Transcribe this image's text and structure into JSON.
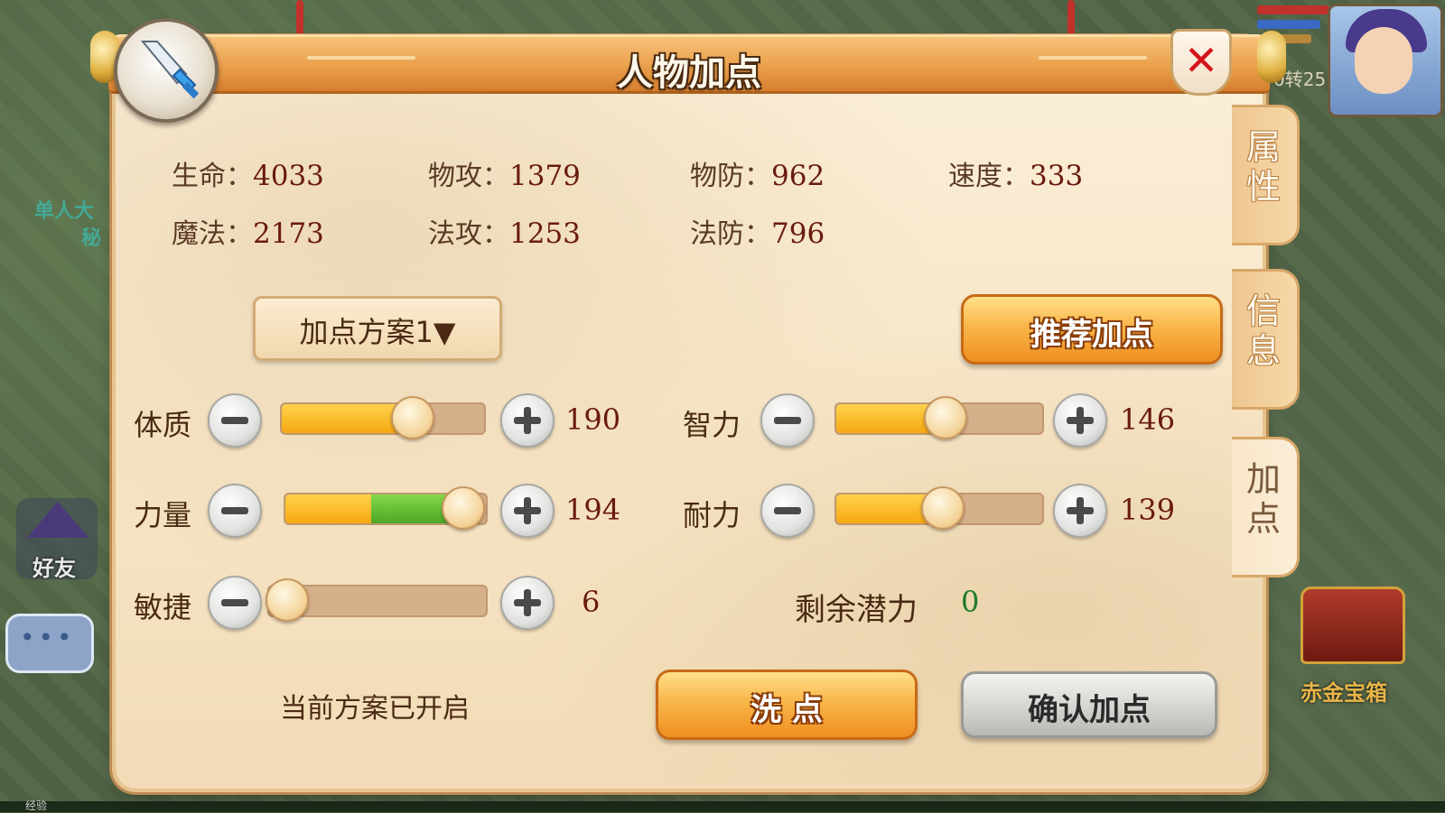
{
  "dialog": {
    "title": "人物加点",
    "close_glyph": "✕"
  },
  "side_tabs": [
    {
      "label": "属性",
      "active": false
    },
    {
      "label": "信息",
      "active": false
    },
    {
      "label": "加点",
      "active": true
    }
  ],
  "stats": [
    {
      "label": "生命：",
      "value": "4033"
    },
    {
      "label": "物攻：",
      "value": "1379"
    },
    {
      "label": "物防：",
      "value": "962"
    },
    {
      "label": "速度：",
      "value": "333"
    },
    {
      "label": "魔法：",
      "value": "2173"
    },
    {
      "label": "法攻：",
      "value": "1253"
    },
    {
      "label": "法防：",
      "value": "796"
    }
  ],
  "scheme_dropdown": {
    "label": "加点方案1▼"
  },
  "recommend_button": {
    "label": "推荐加点"
  },
  "attributes": [
    {
      "label": "体质",
      "value": "190",
      "base_fraction": 0.64,
      "added_fraction": 0.0
    },
    {
      "label": "智力",
      "value": "146",
      "base_fraction": 0.52,
      "added_fraction": 0.0
    },
    {
      "label": "力量",
      "value": "194",
      "base_fraction": 0.43,
      "added_fraction": 0.45
    },
    {
      "label": "耐力",
      "value": "139",
      "base_fraction": 0.51,
      "added_fraction": 0.0
    },
    {
      "label": "敏捷",
      "value": "6",
      "base_fraction": 0.0,
      "added_fraction": 0.0
    }
  ],
  "remaining_potential": {
    "label": "剩余潜力",
    "value": "0"
  },
  "scheme_status": "当前方案已开启",
  "reset_button": {
    "label": "洗 点"
  },
  "confirm_button": {
    "label": "确认加点"
  },
  "background": {
    "friends_label": "好友",
    "chest_label": "赤金宝箱",
    "level_text": "0转25",
    "left_event_text": "单人大",
    "left_event_text2": "秘",
    "exp_label": "经验"
  },
  "colors": {
    "title_bar": "#ea9f4a",
    "stat_value": "#6a1a0e",
    "remaining_value": "#1e7a2a",
    "close_x": "#d4141c",
    "slider_fill": "#f6a812",
    "slider_added": "#4ca824"
  },
  "icons": {
    "weapon_badge": "sword-icon",
    "close": "close-icon",
    "minus": "minus-icon",
    "plus": "plus-icon"
  }
}
